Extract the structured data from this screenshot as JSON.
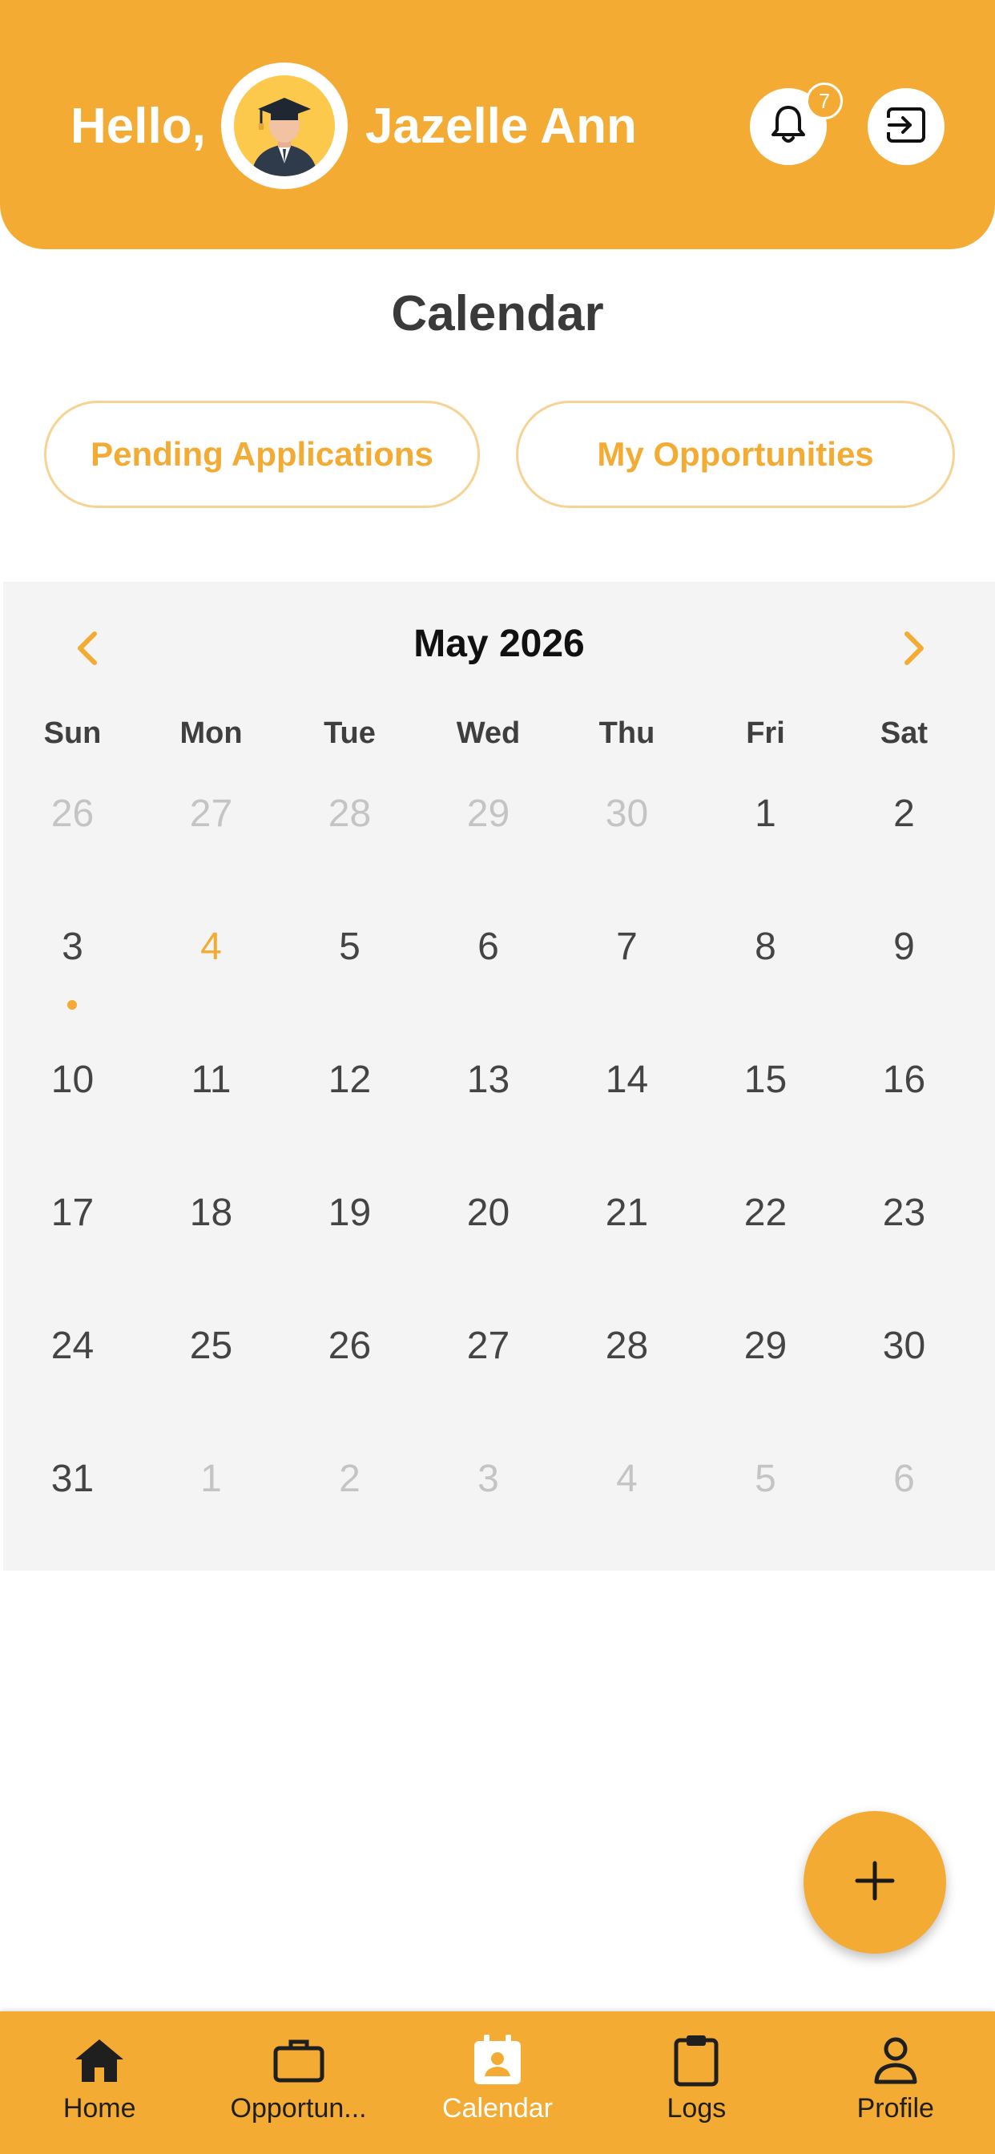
{
  "header": {
    "greeting": "Hello,",
    "username": "Jazelle Ann",
    "notification_count": "7",
    "avatar_icon": "graduate-avatar-icon",
    "bell_icon": "bell-icon",
    "logout_icon": "logout-icon"
  },
  "page_title": "Calendar",
  "filters": {
    "pending_label": "Pending Applications",
    "opportunities_label": "My Opportunities"
  },
  "calendar": {
    "month_label": "May 2026",
    "prev_icon": "chevron-left-icon",
    "next_icon": "chevron-right-icon",
    "weekdays": [
      "Sun",
      "Mon",
      "Tue",
      "Wed",
      "Thu",
      "Fri",
      "Sat"
    ],
    "weeks": [
      [
        {
          "d": "26",
          "m": true
        },
        {
          "d": "27",
          "m": true
        },
        {
          "d": "28",
          "m": true
        },
        {
          "d": "29",
          "m": true
        },
        {
          "d": "30",
          "m": true
        },
        {
          "d": "1"
        },
        {
          "d": "2"
        }
      ],
      [
        {
          "d": "3",
          "dot": true
        },
        {
          "d": "4",
          "today": true
        },
        {
          "d": "5"
        },
        {
          "d": "6"
        },
        {
          "d": "7"
        },
        {
          "d": "8"
        },
        {
          "d": "9"
        }
      ],
      [
        {
          "d": "10"
        },
        {
          "d": "11"
        },
        {
          "d": "12"
        },
        {
          "d": "13"
        },
        {
          "d": "14"
        },
        {
          "d": "15"
        },
        {
          "d": "16"
        }
      ],
      [
        {
          "d": "17"
        },
        {
          "d": "18"
        },
        {
          "d": "19"
        },
        {
          "d": "20"
        },
        {
          "d": "21"
        },
        {
          "d": "22"
        },
        {
          "d": "23"
        }
      ],
      [
        {
          "d": "24"
        },
        {
          "d": "25"
        },
        {
          "d": "26"
        },
        {
          "d": "27"
        },
        {
          "d": "28"
        },
        {
          "d": "29"
        },
        {
          "d": "30"
        }
      ],
      [
        {
          "d": "31"
        },
        {
          "d": "1",
          "m": true
        },
        {
          "d": "2",
          "m": true
        },
        {
          "d": "3",
          "m": true
        },
        {
          "d": "4",
          "m": true
        },
        {
          "d": "5",
          "m": true
        },
        {
          "d": "6",
          "m": true
        }
      ]
    ]
  },
  "fab": {
    "icon": "plus-icon"
  },
  "bottom_nav": {
    "items": [
      {
        "label": "Home",
        "icon": "home-icon"
      },
      {
        "label": "Opportun...",
        "icon": "briefcase-icon"
      },
      {
        "label": "Calendar",
        "icon": "calendar-icon",
        "active": true
      },
      {
        "label": "Logs",
        "icon": "clipboard-icon"
      },
      {
        "label": "Profile",
        "icon": "person-icon"
      }
    ]
  },
  "colors": {
    "accent": "#F3AB33",
    "calendar_bg": "#F4F4F4",
    "muted_day": "#C4C4C4"
  }
}
